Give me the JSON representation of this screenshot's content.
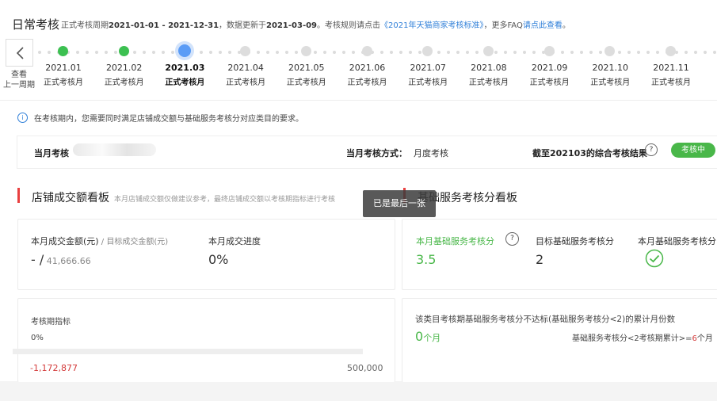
{
  "header": {
    "title": "日常考核",
    "period_prefix": "正式考核周期",
    "period_range": "2021-01-01 - 2021-12-31",
    "update_prefix": "，数据更新于",
    "update_date": "2021-03-09",
    "rule_prefix": "。考核规则请点击",
    "rule_link": "《2021年天猫商家考核标准》",
    "faq_prefix": "，更多FAQ",
    "faq_link": "请点此查看",
    "faq_suffix": "。"
  },
  "timeline": {
    "prev_label_line1": "查看",
    "prev_label_line2": "上一周期",
    "months": [
      {
        "date": "2021.01",
        "label": "正式考核月",
        "state": "done"
      },
      {
        "date": "2021.02",
        "label": "正式考核月",
        "state": "done"
      },
      {
        "date": "2021.03",
        "label": "正式考核月",
        "state": "current"
      },
      {
        "date": "2021.04",
        "label": "正式考核月",
        "state": "future"
      },
      {
        "date": "2021.05",
        "label": "正式考核月",
        "state": "future"
      },
      {
        "date": "2021.06",
        "label": "正式考核月",
        "state": "future"
      },
      {
        "date": "2021.07",
        "label": "正式考核月",
        "state": "future"
      },
      {
        "date": "2021.08",
        "label": "正式考核月",
        "state": "future"
      },
      {
        "date": "2021.09",
        "label": "正式考核月",
        "state": "future"
      },
      {
        "date": "2021.10",
        "label": "正式考核月",
        "state": "future"
      },
      {
        "date": "2021.11",
        "label": "正式考核月",
        "state": "future"
      },
      {
        "date": "",
        "label": "",
        "state": "future"
      }
    ]
  },
  "info": {
    "text": "在考核期内，您需要同时满足店铺成交额与基础服务考核分对应类目的要求。"
  },
  "assessment": {
    "label": "当月考核",
    "method_label": "当月考核方式：",
    "method_value": "月度考核",
    "result_label": "截至202103的综合考核结果",
    "status": "考核中"
  },
  "sales_board": {
    "title": "店铺成交额看板",
    "note": "本月店铺成交额仅做建议参考，最终店铺成交额以考核期指标进行考核",
    "gmv_label": "本月成交金额(元)",
    "target_label": " / 目标成交金额(元)",
    "gmv_value": "- /",
    "target_value": " 41,666.66",
    "progress_label": "本月成交进度",
    "progress_value": "0%",
    "period_metric_label": "考核期指标",
    "period_progress_text": "0%",
    "period_progress_fraction": 0,
    "current_value": "-1,172,877",
    "target_total": "500,000"
  },
  "service_board": {
    "title": "基础服务考核分看板",
    "score_label": "本月基础服务考核分",
    "score_value": "3.5",
    "target_label": "目标基础服务考核分",
    "target_value": "2",
    "third_label": "本月基础服务考核分",
    "fail_label": "该类目考核期基础服务考核分不达标(基础服务考核分<2)的累计月份数",
    "fail_count": "0",
    "fail_unit": "个月",
    "rule_text": "基础服务考核分<2考核期累计>=",
    "rule_num": "6",
    "rule_unit": "个月"
  },
  "toast": {
    "text": "已是最后一张"
  },
  "colors": {
    "accent_green": "#49b749",
    "current_blue": "#5b9cf6",
    "red_bar": "#e94040",
    "link_blue": "#2f7fd8"
  }
}
